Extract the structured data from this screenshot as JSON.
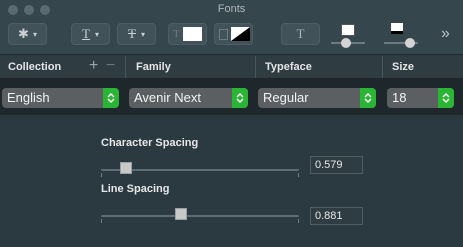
{
  "window": {
    "title": "Fonts"
  },
  "toolbar": {
    "action_icon": "gear-icon",
    "underline_icon": "text-underline-icon",
    "strikethrough_icon": "text-strikethrough-icon",
    "text_color_icon": "text-color-icon",
    "document_color_icon": "document-color-icon",
    "shadow_icon": "text-shadow-icon",
    "overflow_icon": "chevron-double-right-icon",
    "overflow_label": "»"
  },
  "columns": {
    "collection": "Collection",
    "family": "Family",
    "typeface": "Typeface",
    "size": "Size"
  },
  "selectors": {
    "collection": "English",
    "family": "Avenir Next",
    "typeface": "Regular",
    "size": "18"
  },
  "character_spacing": {
    "label": "Character Spacing",
    "value": "0.579",
    "position": 0.1
  },
  "line_spacing": {
    "label": "Line Spacing",
    "value": "0.881",
    "position": 0.4
  }
}
